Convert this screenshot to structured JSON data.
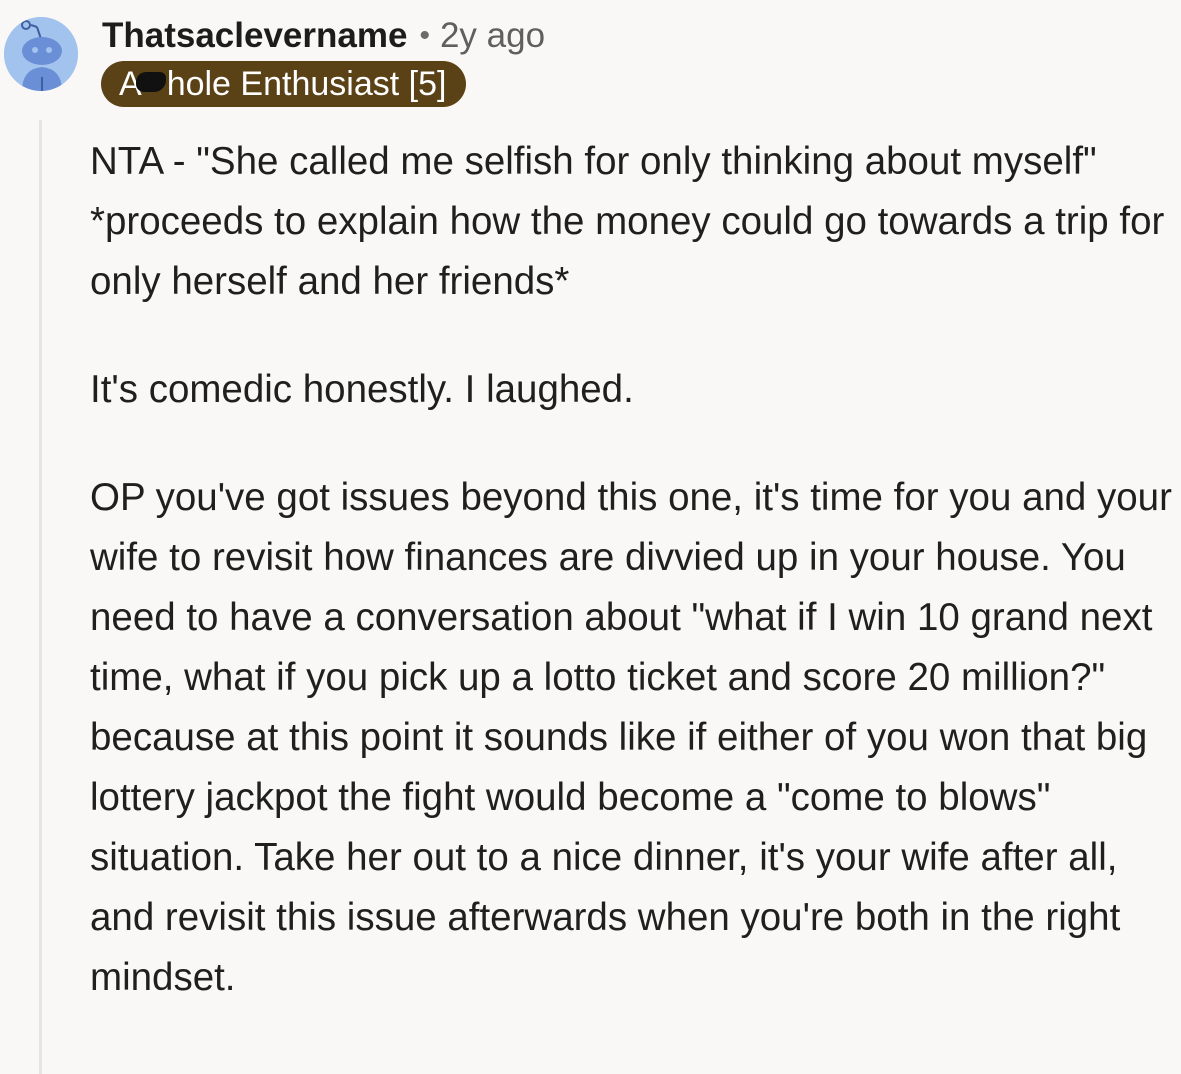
{
  "comment": {
    "username": "Thatsaclevername",
    "separator": "•",
    "timestamp": "2y ago",
    "flair": {
      "prefix": "A",
      "suffix": "hole Enthusiast [5]",
      "background_color": "#5b4116"
    },
    "paragraphs": [
      "NTA - \"She called me selfish for only thinking about myself\" *proceeds to explain how the money could go towards a trip for only herself and her friends*",
      "It's comedic honestly. I laughed.",
      "OP you've got issues beyond this one, it's time for you and your wife to revisit how finances are divvied up in your house. You need to have a conversation about \"what if I win 10 grand next time, what if you pick up a lotto ticket and score 20 million?\" because at this point it sounds like if either of you won that big lottery jackpot the fight would become a \"come to blows\" situation. Take her out to a nice dinner, it's your wife after all, and revisit this issue afterwards when you're both in the right mindset."
    ]
  },
  "colors": {
    "avatar_background": "#a3c3ef",
    "avatar_figure": "#6a8fd6",
    "page_background": "#f9f8f6",
    "thread_line": "#e7e5e2"
  },
  "icons": {
    "avatar": "snoo-avatar-icon"
  }
}
